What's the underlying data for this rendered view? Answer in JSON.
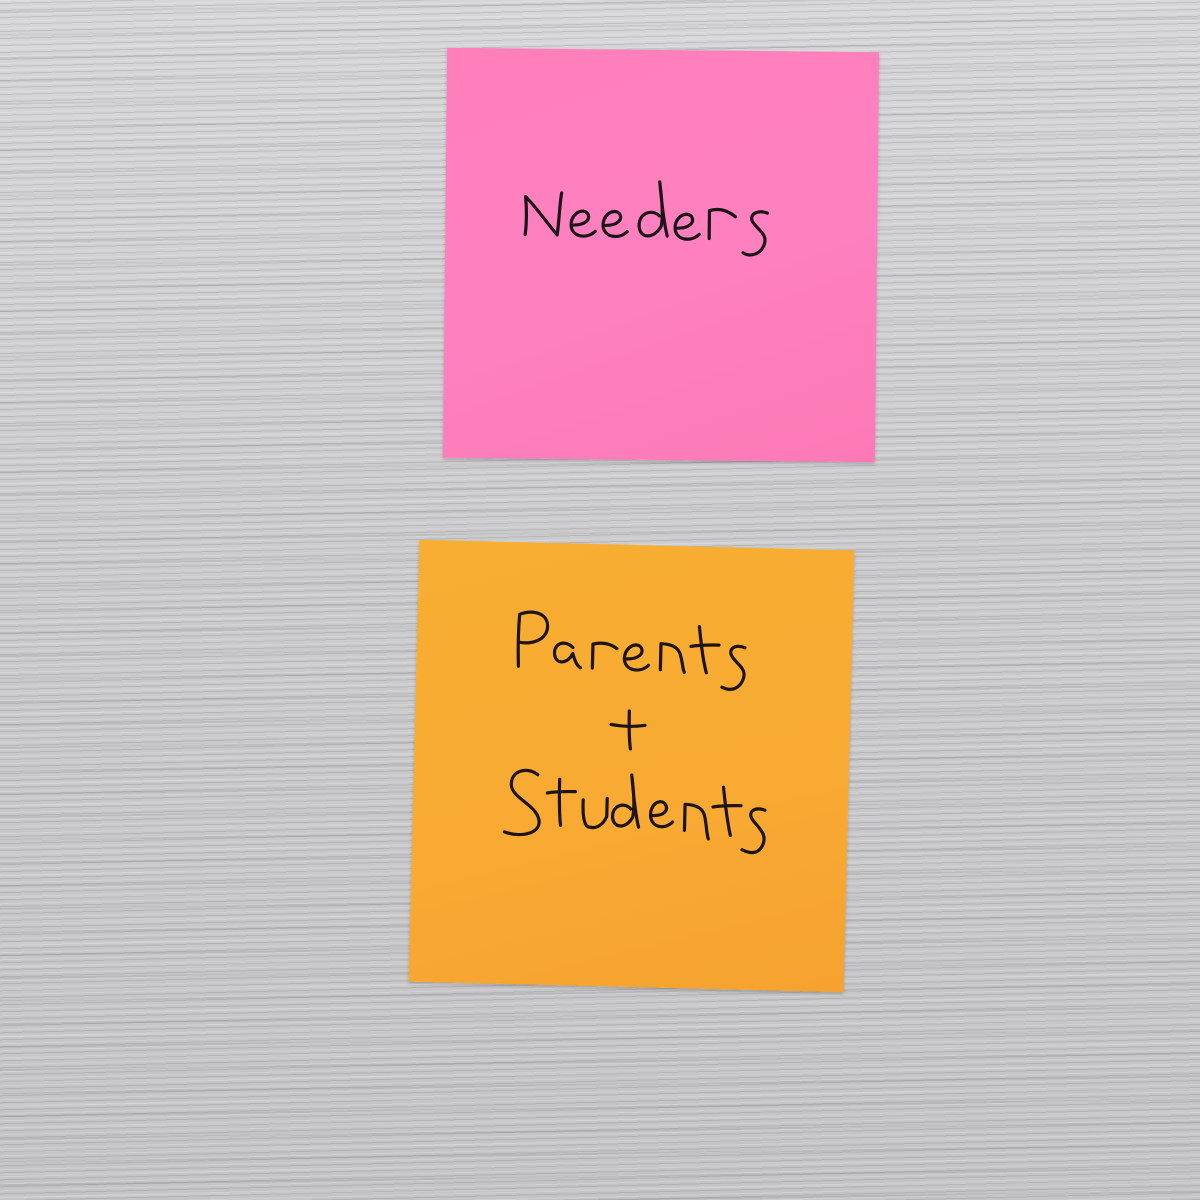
{
  "scene": {
    "surface_color": "#c9c8c9"
  },
  "notes": [
    {
      "id": "needers",
      "color": "#ff7fbb",
      "lines": [
        "Needers"
      ]
    },
    {
      "id": "parents-students",
      "color": "#f7ae32",
      "lines": [
        "Parents",
        "+",
        "Students"
      ]
    }
  ]
}
